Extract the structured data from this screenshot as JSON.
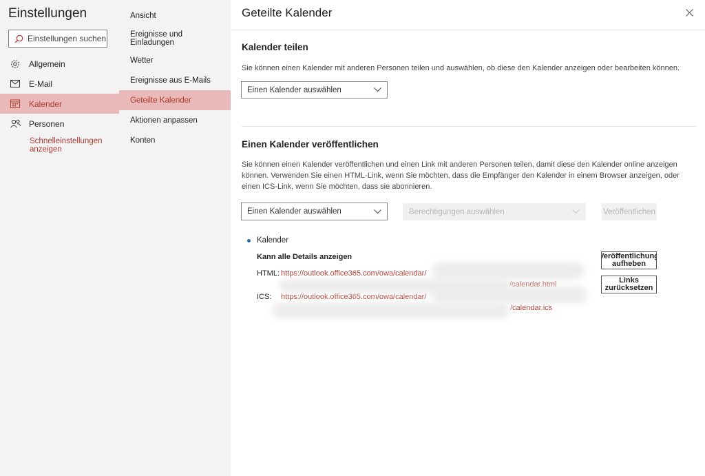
{
  "app": {
    "title": "Einstellungen"
  },
  "search": {
    "placeholder": "Einstellungen suchen"
  },
  "nav": {
    "items": [
      {
        "label": "Allgemein",
        "icon": "gear-icon"
      },
      {
        "label": "E-Mail",
        "icon": "mail-icon"
      },
      {
        "label": "Kalender",
        "icon": "calendar-icon",
        "active": true
      },
      {
        "label": "Personen",
        "icon": "people-icon"
      }
    ],
    "quick_settings": "Schnelleinstellungen anzeigen"
  },
  "subnav": {
    "items": [
      {
        "label": "Ansicht"
      },
      {
        "label": "Ereignisse und Einladungen"
      },
      {
        "label": "Wetter"
      },
      {
        "label": "Ereignisse aus E-Mails"
      },
      {
        "label": "Geteilte Kalender",
        "active": true
      },
      {
        "label": "Aktionen anpassen"
      },
      {
        "label": "Konten"
      }
    ]
  },
  "main": {
    "title": "Geteilte Kalender",
    "share": {
      "title": "Kalender teilen",
      "description": "Sie können einen Kalender mit anderen Personen teilen und auswählen, ob diese den Kalender anzeigen oder bearbeiten können.",
      "select_label": "Einen Kalender auswählen"
    },
    "publish": {
      "title": "Einen Kalender veröffentlichen",
      "description": "Sie können einen Kalender veröffentlichen und einen Link mit anderen Personen teilen, damit diese den Kalender online anzeigen können. Verwenden Sie einen HTML-Link, wenn Sie möchten, dass die Empfänger den Kalender in einem Browser anzeigen, oder einen ICS-Link, wenn Sie möchten, dass sie abonnieren.",
      "calendar_select_label": "Einen Kalender auswählen",
      "permission_select_label": "Berechtigungen auswählen",
      "publish_button": "Veröffentlichen"
    },
    "published": {
      "calendar_name": "Kalender",
      "permission": "Kann alle Details anzeigen",
      "html_label": "HTML:",
      "html_link_start": "https://outlook.office365.com/owa/calendar/",
      "html_link_end": "/calendar.html",
      "ics_label": "ICS:",
      "ics_link_start": "https://outlook.office365.com/owa/calendar/",
      "ics_link_end": "/calendar.ics",
      "unpublish_line1": "Veröffentlichung",
      "unpublish_line2": "aufheben",
      "reset_line1": "Links",
      "reset_line2": "zurücksetzen"
    }
  },
  "colors": {
    "accent": "#b03a2e",
    "active_bg": "#e8b9b8",
    "pane_bg": "#f3f3f3"
  }
}
